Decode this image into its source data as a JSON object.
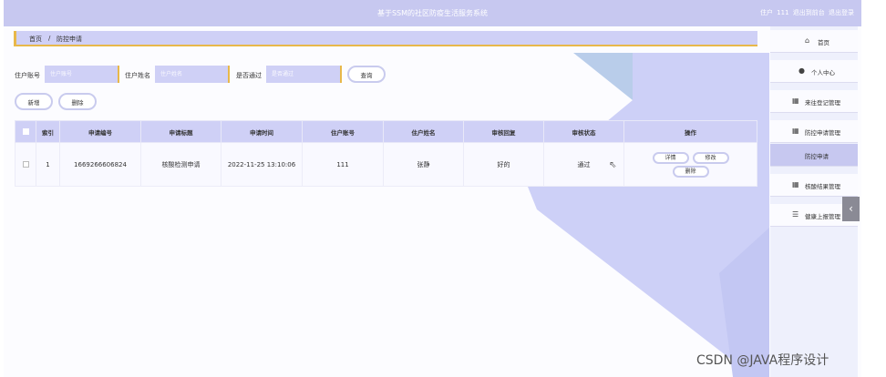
{
  "header": {
    "title": "基于SSM的社区防疫生活服务系统",
    "user_text": "住户 111",
    "back_link": "退出到前台",
    "logout_link": "退出登录"
  },
  "breadcrumb": {
    "home": "首页",
    "sep": "/",
    "current": "防控申请"
  },
  "search": {
    "account_label": "住户账号",
    "account_placeholder": "住户账号",
    "name_label": "住户姓名",
    "name_placeholder": "住户姓名",
    "passed_label": "是否通过",
    "passed_placeholder": "是否通过",
    "query_button": "查询"
  },
  "actions": {
    "add": "新增",
    "delete": "删除"
  },
  "table": {
    "headers": [
      "索引",
      "申请编号",
      "申请标题",
      "申请时间",
      "住户账号",
      "住户姓名",
      "审核回复",
      "审核状态",
      "操作"
    ],
    "rows": [
      {
        "index": "1",
        "code": "1669266606824",
        "title": "核酸检测申请",
        "time": "2022-11-25 13:10:06",
        "account": "111",
        "name": "张静",
        "reply": "好的",
        "status": "通过",
        "btn_detail": "详情",
        "btn_edit": "修改",
        "btn_delete": "删除"
      }
    ]
  },
  "sidebar": {
    "items": [
      {
        "label": "首页",
        "icon": "home-icon"
      },
      {
        "label": "个人中心",
        "icon": "user-icon"
      },
      {
        "label": "来往登记管理",
        "icon": "grid-icon"
      },
      {
        "label": "防控申请管理",
        "icon": "grid-icon"
      },
      {
        "label": "防控申请",
        "icon": ""
      },
      {
        "label": "核酸结果管理",
        "icon": "grid-icon"
      },
      {
        "label": "健康上报管理",
        "icon": "list-icon"
      }
    ],
    "collapse_icon": "chevron-left-icon"
  },
  "watermark": "CSDN @JAVA程序设计",
  "colors": {
    "header": "#c7c8f0",
    "accent": "#e8b84a",
    "input": "#cfd0f6",
    "bg_shape": "#cdd0f7"
  }
}
